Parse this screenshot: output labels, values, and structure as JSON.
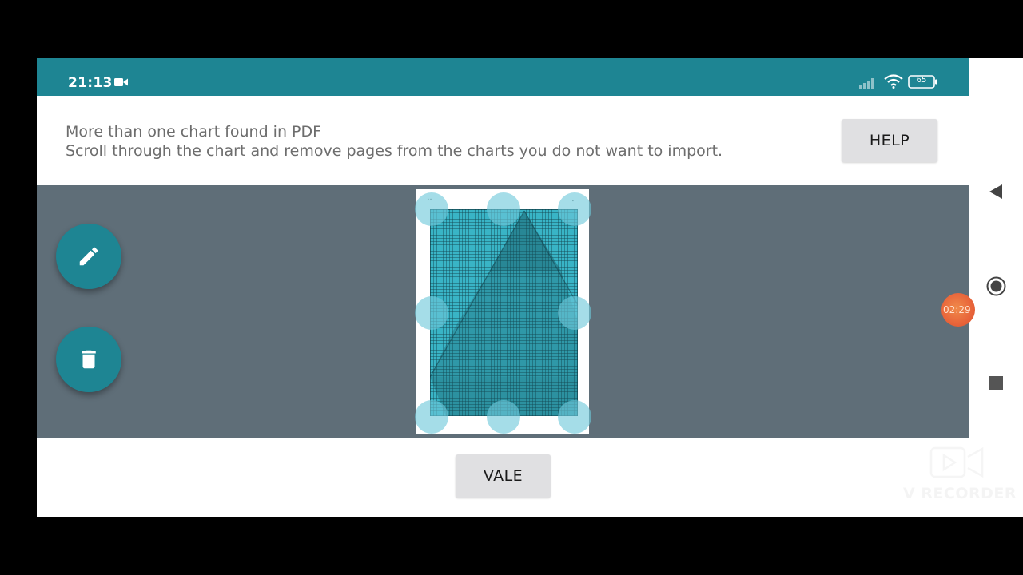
{
  "status_bar": {
    "time": "21:13",
    "battery_level": "65",
    "icons": [
      "video-record-icon",
      "signal-icon",
      "wifi-icon",
      "battery-icon"
    ]
  },
  "header": {
    "line1": "More than one chart found in PDF",
    "line2": "Scroll through the chart and remove pages from the charts you do not want to import.",
    "help_label": "HELP"
  },
  "preview": {
    "fab_icons": [
      "pencil-icon",
      "trash-icon"
    ]
  },
  "footer": {
    "ok_label": "VALE"
  },
  "recorder": {
    "timer": "02:29",
    "watermark": "V RECORDER"
  },
  "nav_bar": {
    "icons": [
      "back-icon",
      "home-icon",
      "recent-apps-icon"
    ]
  },
  "colors": {
    "accent": "#1e8593",
    "preview_bg": "#5f6e78",
    "chart_fill": "#39b4c6",
    "button_bg": "#e0e0e2",
    "recorder_orange": "#e8643a"
  }
}
